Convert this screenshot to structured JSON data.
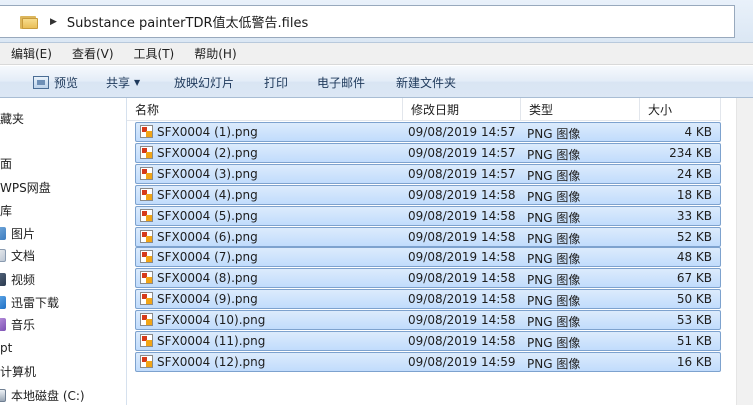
{
  "address": {
    "path": "Substance painterTDR值太低警告.files"
  },
  "menu": [
    {
      "label": "编辑(E)"
    },
    {
      "label": "查看(V)"
    },
    {
      "label": "工具(T)"
    },
    {
      "label": "帮助(H)"
    }
  ],
  "toolbar": {
    "preview": "预览",
    "share": "共享",
    "slideshow": "放映幻灯片",
    "print": "打印",
    "email": "电子邮件",
    "new_folder": "新建文件夹"
  },
  "sidebar": {
    "items": [
      {
        "label": "藏夹"
      },
      {
        "label": "面"
      },
      {
        "label": "WPS网盘"
      },
      {
        "label": "库"
      },
      {
        "label": "图片"
      },
      {
        "label": "文档"
      },
      {
        "label": "视频"
      },
      {
        "label": "迅雷下载"
      },
      {
        "label": "音乐"
      },
      {
        "label": "pt"
      },
      {
        "label": "计算机"
      },
      {
        "label": "本地磁盘 (C:)"
      }
    ]
  },
  "columns": {
    "name": "名称",
    "date": "修改日期",
    "type": "类型",
    "size": "大小"
  },
  "files": [
    {
      "name": "SFX0004 (1).png",
      "date": "09/08/2019 14:57",
      "type": "PNG 图像",
      "size": "4 KB"
    },
    {
      "name": "SFX0004 (2).png",
      "date": "09/08/2019 14:57",
      "type": "PNG 图像",
      "size": "234 KB"
    },
    {
      "name": "SFX0004 (3).png",
      "date": "09/08/2019 14:57",
      "type": "PNG 图像",
      "size": "24 KB"
    },
    {
      "name": "SFX0004 (4).png",
      "date": "09/08/2019 14:58",
      "type": "PNG 图像",
      "size": "18 KB"
    },
    {
      "name": "SFX0004 (5).png",
      "date": "09/08/2019 14:58",
      "type": "PNG 图像",
      "size": "33 KB"
    },
    {
      "name": "SFX0004 (6).png",
      "date": "09/08/2019 14:58",
      "type": "PNG 图像",
      "size": "52 KB"
    },
    {
      "name": "SFX0004 (7).png",
      "date": "09/08/2019 14:58",
      "type": "PNG 图像",
      "size": "48 KB"
    },
    {
      "name": "SFX0004 (8).png",
      "date": "09/08/2019 14:58",
      "type": "PNG 图像",
      "size": "67 KB"
    },
    {
      "name": "SFX0004 (9).png",
      "date": "09/08/2019 14:58",
      "type": "PNG 图像",
      "size": "50 KB"
    },
    {
      "name": "SFX0004 (10).png",
      "date": "09/08/2019 14:58",
      "type": "PNG 图像",
      "size": "53 KB"
    },
    {
      "name": "SFX0004 (11).png",
      "date": "09/08/2019 14:58",
      "type": "PNG 图像",
      "size": "51 KB"
    },
    {
      "name": "SFX0004 (12).png",
      "date": "09/08/2019 14:59",
      "type": "PNG 图像",
      "size": "16 KB"
    }
  ],
  "colors": {
    "selection": "#cce4fc",
    "selection_border": "#7da2ce",
    "toolbar_text": "#1e395b"
  }
}
